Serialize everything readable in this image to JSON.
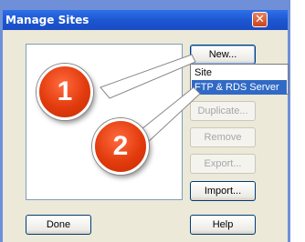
{
  "window": {
    "title": "Manage Sites",
    "close_glyph": "✕"
  },
  "buttons": {
    "new": "New...",
    "duplicate": "Duplicate...",
    "remove": "Remove",
    "export": "Export...",
    "import": "Import...",
    "done": "Done",
    "help": "Help"
  },
  "new_menu": {
    "items": [
      {
        "label": "Site",
        "selected": false
      },
      {
        "label": "FTP & RDS Server",
        "selected": true
      }
    ]
  },
  "callouts": [
    {
      "label": "1",
      "color": "#e23b0d"
    },
    {
      "label": "2",
      "color": "#e23b0d"
    }
  ],
  "colors": {
    "titlebar": "#1b55cf",
    "selection": "#316ac5",
    "dialog_face": "#ece9d8"
  }
}
